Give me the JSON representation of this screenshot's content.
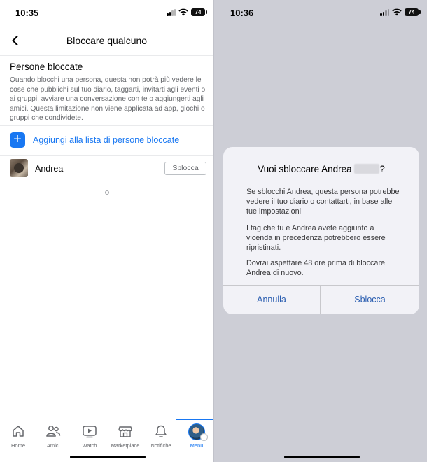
{
  "left_screen": {
    "status_time": "10:35",
    "battery": "74",
    "header_title": "Bloccare qualcuno",
    "section_title": "Persone bloccate",
    "description": "Quando blocchi una persona, questa non potrà più vedere le cose che pubblichi sul tuo diario, taggarti, invitarti agli eventi o ai gruppi, avviare una conversazione con te o aggiungerti agli amici. Questa limitazione non viene applicata ad app, giochi o gruppi che condividete.",
    "add_label": "Aggiungi alla lista di persone bloccate",
    "blocked_user": {
      "name": "Andrea",
      "button": "Sblocca"
    },
    "tabs": [
      {
        "label": "Home",
        "icon": "home-icon"
      },
      {
        "label": "Amici",
        "icon": "friends-icon"
      },
      {
        "label": "Watch",
        "icon": "watch-icon"
      },
      {
        "label": "Marketplace",
        "icon": "marketplace-icon"
      },
      {
        "label": "Notifiche",
        "icon": "bell-icon"
      },
      {
        "label": "Menu",
        "icon": "menu-avatar",
        "active": true
      }
    ]
  },
  "right_screen": {
    "status_time": "10:36",
    "battery": "74",
    "dialog": {
      "title_prefix": "Vuoi sbloccare Andrea",
      "title_suffix": "?",
      "paragraph1": "Se sblocchi Andrea, questa persona potrebbe vedere il tuo diario o contattarti, in base alle tue impostazioni.",
      "paragraph2": "I tag che tu e Andrea avete aggiunto a vicenda in precedenza potrebbero essere ripristinati.",
      "paragraph3": "Dovrai aspettare 48 ore prima di bloccare Andrea di nuovo.",
      "cancel": "Annulla",
      "confirm": "Sblocca"
    }
  },
  "colors": {
    "accent": "#1877f2",
    "dialog_button": "#2a5db0",
    "overlay": "#cdced6"
  }
}
